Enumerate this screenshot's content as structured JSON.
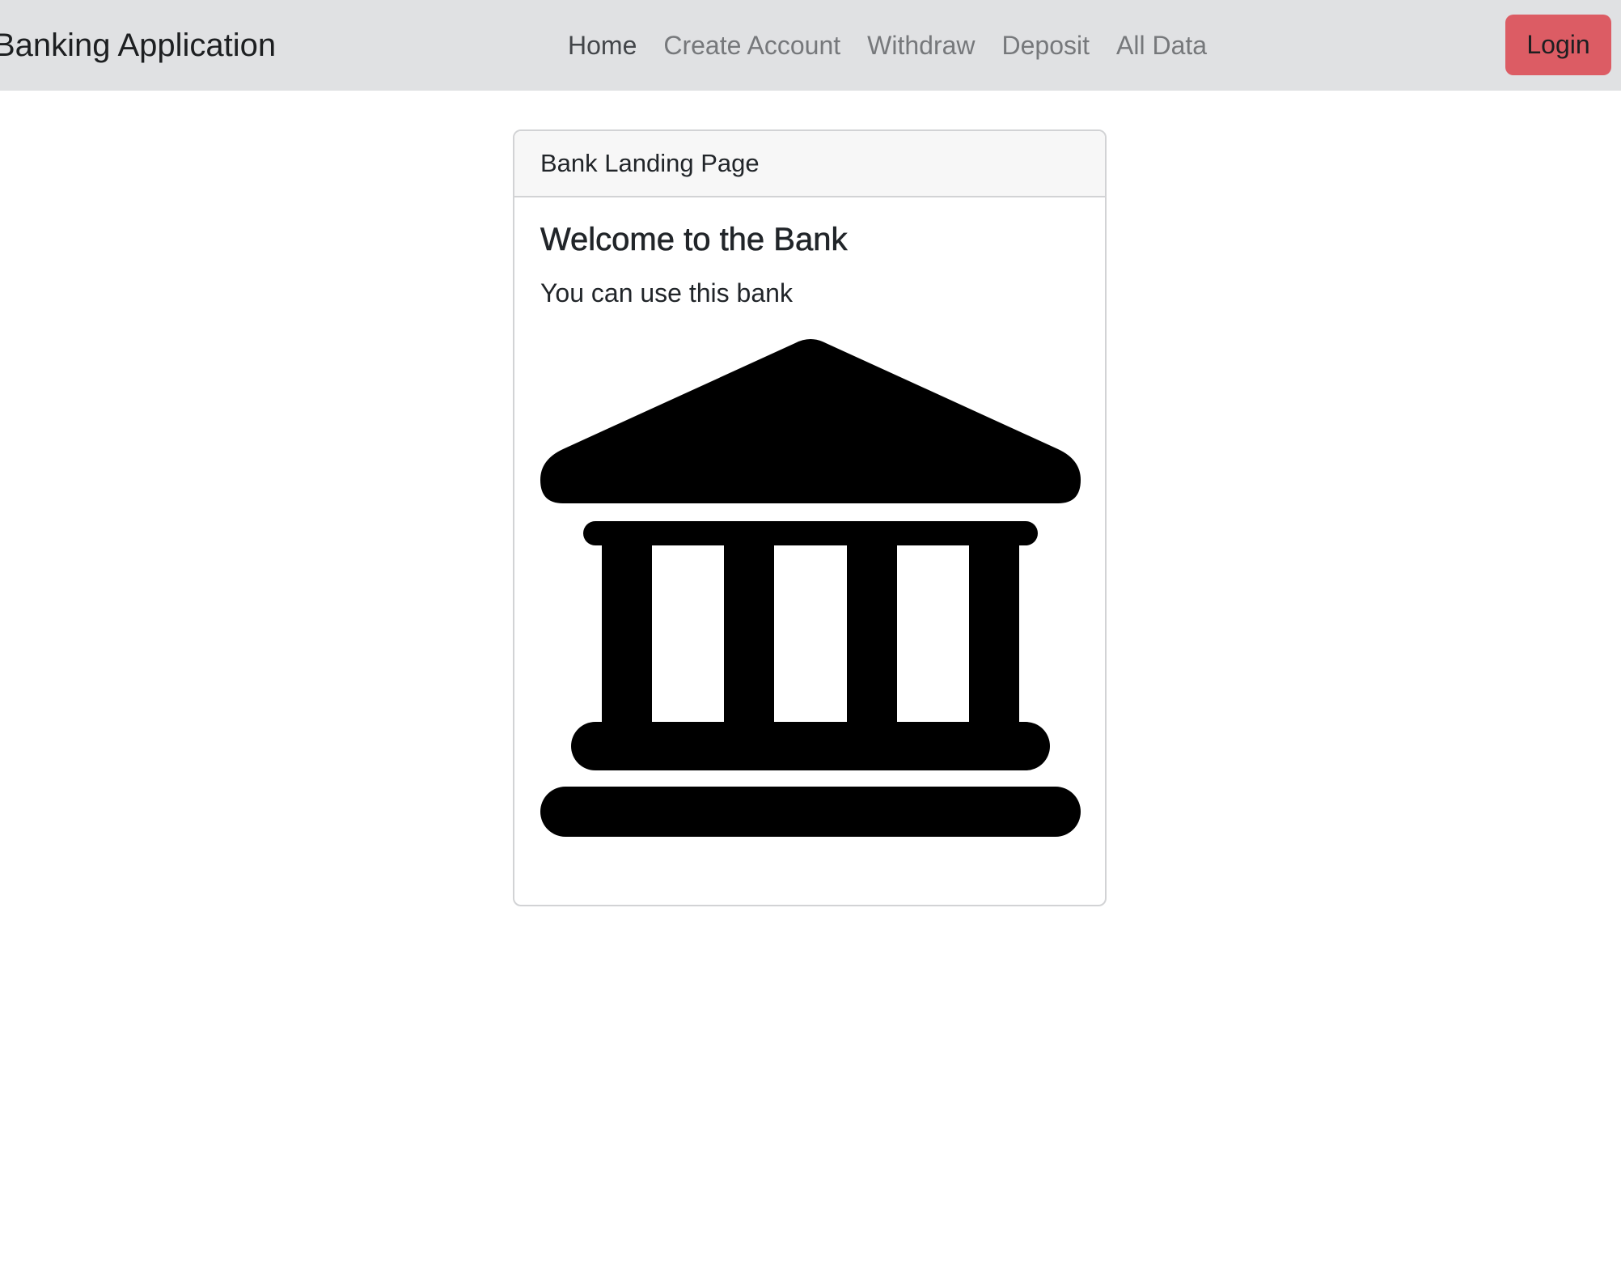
{
  "navbar": {
    "brand": "Banking Application",
    "links": [
      {
        "label": "Home",
        "active": true
      },
      {
        "label": "Create Account",
        "active": false
      },
      {
        "label": "Withdraw",
        "active": false
      },
      {
        "label": "Deposit",
        "active": false
      },
      {
        "label": "All Data",
        "active": false
      }
    ],
    "login_label": "Login"
  },
  "card": {
    "header": "Bank Landing Page",
    "title": "Welcome to the Bank",
    "text": "You can use this bank",
    "image_icon": "bank-icon"
  },
  "colors": {
    "navbar_bg": "#e0e1e3",
    "login_button": "#dc5c64",
    "card_header_bg": "#f7f7f7",
    "card_border": "#d2d3d5"
  }
}
